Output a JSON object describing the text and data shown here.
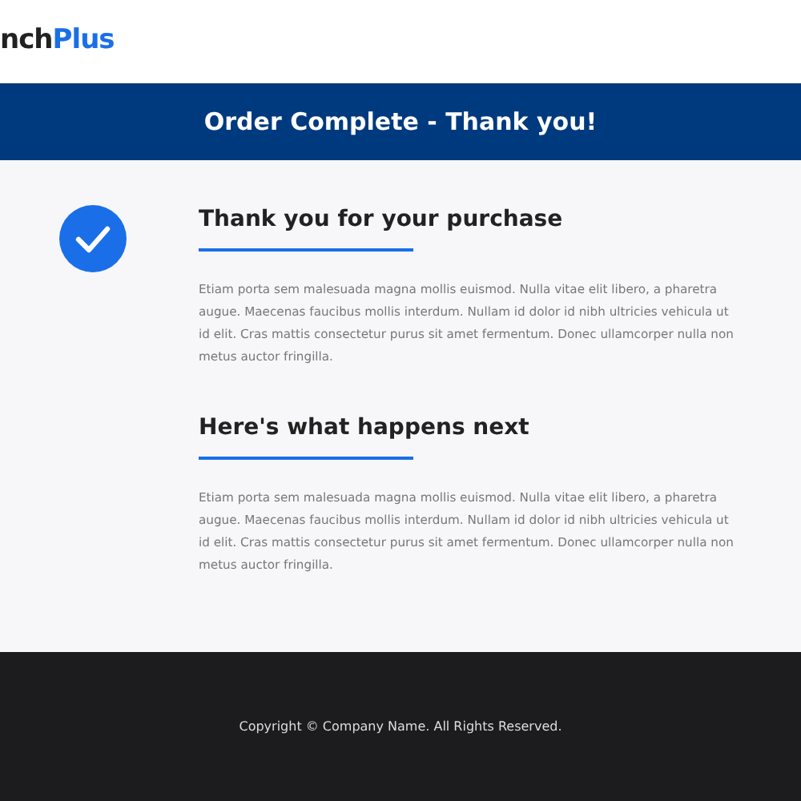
{
  "logo": {
    "dark": "nch",
    "accent": "Plus"
  },
  "banner": {
    "title": "Order Complete - Thank you!"
  },
  "sections": [
    {
      "heading": "Thank you for your purchase",
      "kind": "confirmed",
      "body": "Etiam porta sem malesuada magna mollis euismod. Nulla vitae elit libero, a pharetra augue. Maecenas faucibus mollis interdum. Nullam id dolor id nibh ultricies vehicula ut id elit. Cras mattis consectetur purus sit amet fermentum. Donec ullamcorper nulla non metus auctor fringilla."
    },
    {
      "heading": "Here's what happens next",
      "kind": "plain",
      "body": "Etiam porta sem malesuada magna mollis euismod. Nulla vitae elit libero, a pharetra augue. Maecenas faucibus mollis interdum. Nullam id dolor id nibh ultricies vehicula ut id elit. Cras mattis consectetur purus sit amet fermentum. Donec ullamcorper nulla non metus auctor fringilla."
    }
  ],
  "footer": {
    "text": "Copyright © Company Name. All Rights Reserved."
  }
}
